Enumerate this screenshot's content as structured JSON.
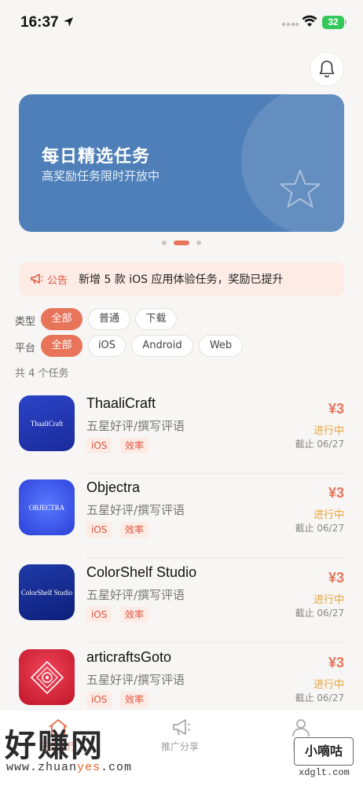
{
  "status_bar": {
    "time": "16:37",
    "battery": "32"
  },
  "banner": {
    "title": "每日精选任务",
    "subtitle": "高奖励任务限时开放中"
  },
  "notice": {
    "label": "公告",
    "text": "新增 5 款 iOS 应用体验任务，奖励已提升"
  },
  "filters": {
    "type_label": "类型",
    "types": [
      "全部",
      "普通",
      "下载"
    ],
    "platform_label": "平台",
    "platforms": [
      "全部",
      "iOS",
      "Android",
      "Web"
    ]
  },
  "count_text": "共 4 个任务",
  "tasks": [
    {
      "name": "ThaaliCraft",
      "subtitle": "五星好评/撰写评语",
      "tags": [
        "iOS",
        "效率"
      ],
      "price": "¥3",
      "status": "进行中",
      "deadline": "截止 06/27",
      "icon_text": "ThaaliCraft"
    },
    {
      "name": "Objectra",
      "subtitle": "五星好评/撰写评语",
      "tags": [
        "iOS",
        "效率"
      ],
      "price": "¥3",
      "status": "进行中",
      "deadline": "截止 06/27",
      "icon_text": "OBJECTRA"
    },
    {
      "name": "ColorShelf Studio",
      "subtitle": "五星好评/撰写评语",
      "tags": [
        "iOS",
        "效率"
      ],
      "price": "¥3",
      "status": "进行中",
      "deadline": "截止 06/27",
      "icon_text": "ColorShelf Studio"
    },
    {
      "name": "articraftsGoto",
      "subtitle": "五星好评/撰写评语",
      "tags": [
        "iOS",
        "效率"
      ],
      "price": "¥3",
      "status": "进行中",
      "deadline": "截止 06/27"
    }
  ],
  "tabbar": {
    "items": [
      {
        "label": "任务大厅",
        "icon": "home-icon"
      },
      {
        "label": "推广分享",
        "icon": "megaphone-icon"
      },
      {
        "label": "我的",
        "icon": "user-icon"
      }
    ]
  },
  "watermarks": {
    "big": "好赚网",
    "url_a": "www.zhuan",
    "url_b": "yes",
    "url_c": ".com",
    "box": "小嘀咕",
    "site": "xdglt.com"
  },
  "colors": {
    "accent": "#e8745a",
    "banner": "#4f7fb8",
    "status_orange": "#e8a23a"
  }
}
